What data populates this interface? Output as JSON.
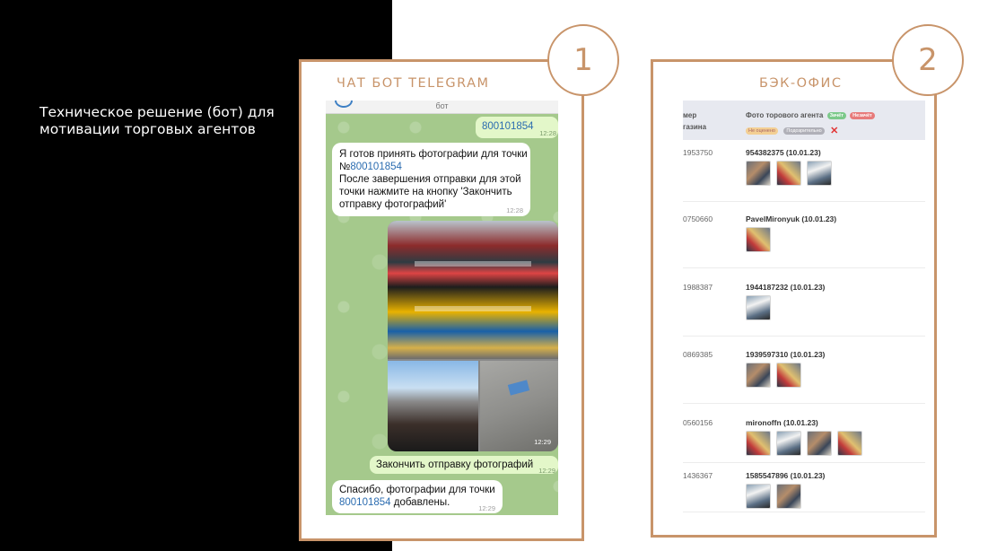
{
  "slide": {
    "title_line1": "Техническое решение (бот) для",
    "title_line2": "мотивации торговых агентов"
  },
  "panel1": {
    "number": "1",
    "title": "ЧАТ БОТ TELEGRAM",
    "chat": {
      "header_name": "бот",
      "messages": [
        {
          "id": "out1",
          "text": "800101854",
          "time": "12:28"
        },
        {
          "id": "in1",
          "line1": "Я готов принять фотографии для точки",
          "line2_prefix": "№",
          "line2_link": "800101854",
          "line3": "После завершения отправки для этой",
          "line4": "точки нажмите на кнопку 'Закончить",
          "line5": "отправку фотографий'",
          "time": "12:28"
        },
        {
          "id": "photos",
          "time": "12:29"
        },
        {
          "id": "out2",
          "text": "Закончить отправку фотографий",
          "time": "12:29"
        },
        {
          "id": "in2",
          "line1": "Спасибо, фотографии для точки",
          "line2_link": "800101854",
          "line2_suffix": " добавлены.",
          "time": "12:29"
        }
      ]
    }
  },
  "panel2": {
    "number": "2",
    "title": "БЭК-ОФИС",
    "table": {
      "col1_line1": "мер",
      "col1_line2": "газина",
      "col2": "Фото торового агента",
      "pills": {
        "green": "Зачёт",
        "red": "Незачёт",
        "yellow": "Не оценено",
        "gray": "Подозрительно"
      },
      "rows": [
        {
          "id": "1953750",
          "agent": "954382375 (10.01.23)",
          "thumbs": 3
        },
        {
          "id": "0750660",
          "agent": "PavelMironyuk (10.01.23)",
          "thumbs": 1
        },
        {
          "id": "1988387",
          "agent": "1944187232 (10.01.23)",
          "thumbs": 1
        },
        {
          "id": "0869385",
          "agent": "1939597310 (10.01.23)",
          "thumbs": 2
        },
        {
          "id": "0560156",
          "agent": "mironoffn (10.01.23)",
          "thumbs": 4
        },
        {
          "id": "1436367",
          "agent": "1585547896 (10.01.23)",
          "thumbs": 2
        }
      ]
    }
  },
  "colors": {
    "accent": "#c8946a",
    "left_bg": "#000000",
    "chat_bg": "#a5c98c",
    "out_bubble": "#e3f7c9",
    "link": "#2b6cb0"
  }
}
